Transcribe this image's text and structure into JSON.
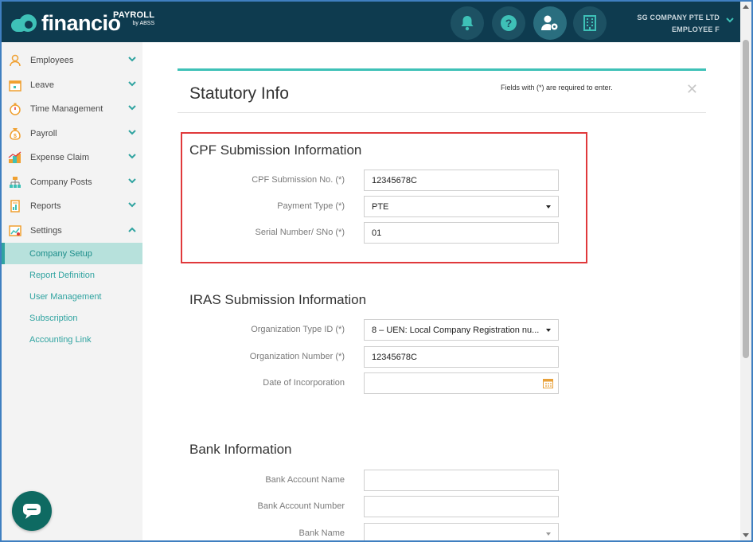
{
  "app": {
    "logo_text": "financio",
    "logo_product": "PAYROLL",
    "logo_byline": "by ABSS"
  },
  "header": {
    "company_name": "SG COMPANY PTE LTD",
    "user_role": "EMPLOYEE F",
    "accent_color": "#3ec1b7",
    "bg_color": "#0e3b4f"
  },
  "sidebar": {
    "items": [
      {
        "label": "Employees",
        "icon": "person-icon",
        "expanded": false
      },
      {
        "label": "Leave",
        "icon": "calendar-icon",
        "expanded": false
      },
      {
        "label": "Time Management",
        "icon": "stopwatch-icon",
        "expanded": false
      },
      {
        "label": "Payroll",
        "icon": "money-bag-icon",
        "expanded": false
      },
      {
        "label": "Expense Claim",
        "icon": "coins-icon",
        "expanded": false
      },
      {
        "label": "Company Posts",
        "icon": "org-chart-icon",
        "expanded": false
      },
      {
        "label": "Reports",
        "icon": "report-icon",
        "expanded": false
      },
      {
        "label": "Settings",
        "icon": "settings-chart-icon",
        "expanded": true
      }
    ],
    "settings_subitems": [
      {
        "label": "Company Setup",
        "active": true
      },
      {
        "label": "Report Definition",
        "active": false
      },
      {
        "label": "User Management",
        "active": false
      },
      {
        "label": "Subscription",
        "active": false
      },
      {
        "label": "Accounting Link",
        "active": false
      }
    ]
  },
  "panel": {
    "title": "Statutory Info",
    "required_note": "Fields with (*) are required to enter.",
    "close_label": "✕"
  },
  "cpf": {
    "title": "CPF Submission Information",
    "submission_no_label": "CPF Submission No. (*)",
    "submission_no_value": "12345678C",
    "payment_type_label": "Payment Type (*)",
    "payment_type_value": "PTE",
    "serial_label": "Serial Number/ SNo (*)",
    "serial_value": "01"
  },
  "iras": {
    "title": "IRAS Submission Information",
    "org_type_label": "Organization Type ID (*)",
    "org_type_value": "8 – UEN: Local Company Registration nu...",
    "org_number_label": "Organization Number (*)",
    "org_number_value": "12345678C",
    "incorporation_label": "Date of Incorporation",
    "incorporation_value": ""
  },
  "bank": {
    "title": "Bank Information",
    "account_name_label": "Bank Account Name",
    "account_name_value": "",
    "account_number_label": "Bank Account Number",
    "account_number_value": "",
    "bank_name_label": "Bank Name",
    "bank_name_value": ""
  }
}
